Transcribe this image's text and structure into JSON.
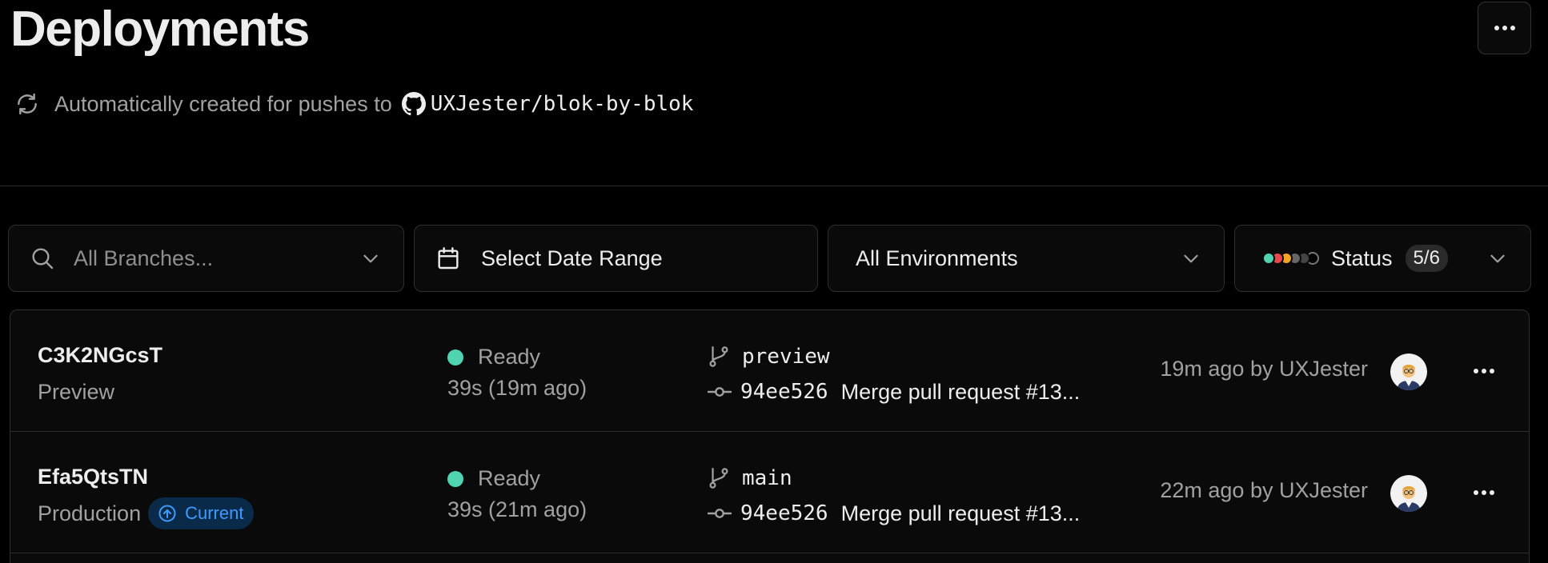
{
  "header": {
    "title": "Deployments",
    "menu_icon": "ellipsis-icon"
  },
  "subtitle": {
    "text": "Automatically created for pushes to",
    "repo": "UXJester/blok-by-blok",
    "icons": [
      "refresh-icon",
      "github-icon"
    ]
  },
  "filters": {
    "branches_placeholder": "All Branches...",
    "date_range_label": "Select Date Range",
    "environments_label": "All Environments",
    "status_label": "Status",
    "status_count": "5/6",
    "status_colors": [
      "#4fd3b0",
      "#e5484d",
      "#f5a524",
      "#666666",
      "#444444",
      "#000000"
    ]
  },
  "deployments": [
    {
      "id": "C3K2NGcsT",
      "environment": "Preview",
      "current_label": "",
      "status": "Ready",
      "status_color": "#4fd3b0",
      "duration": "39s (19m ago)",
      "branch": "preview",
      "commit_hash": "94ee526",
      "commit_message": "Merge pull request #13...",
      "when": "19m ago by UXJester"
    },
    {
      "id": "Efa5QtsTN",
      "environment": "Production",
      "current_label": "Current",
      "status": "Ready",
      "status_color": "#4fd3b0",
      "duration": "39s (21m ago)",
      "branch": "main",
      "commit_hash": "94ee526",
      "commit_message": "Merge pull request #13...",
      "when": "22m ago by UXJester"
    }
  ]
}
